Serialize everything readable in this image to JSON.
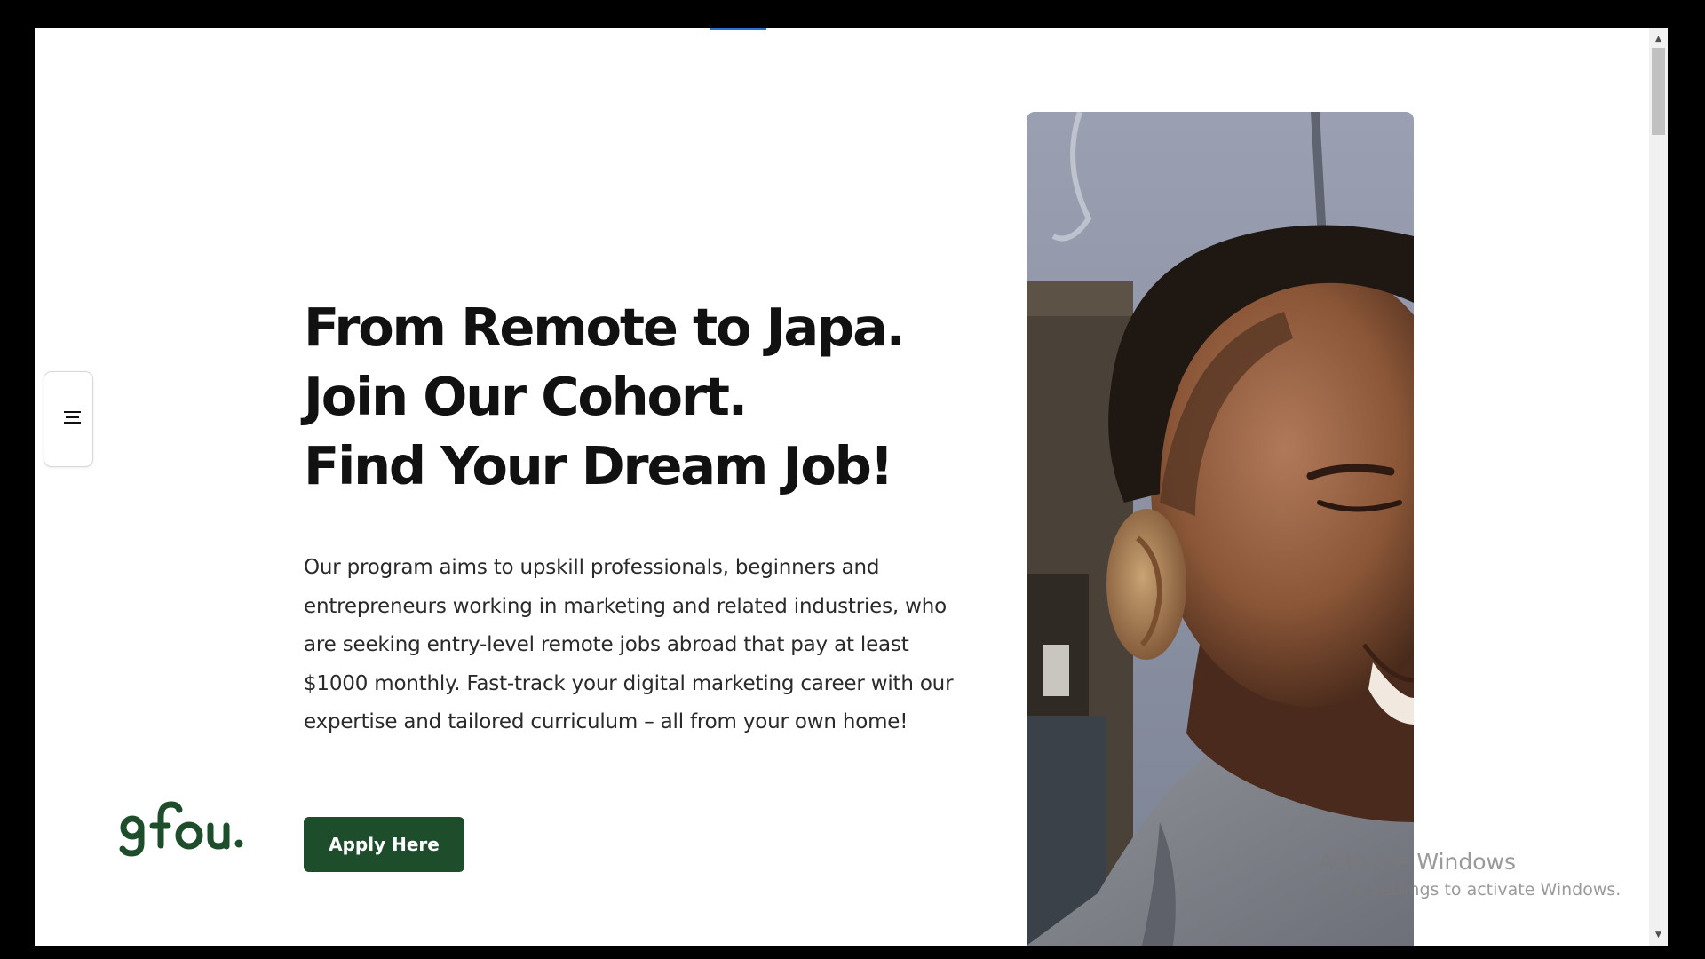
{
  "hero": {
    "headline": [
      "From Remote to Japa.",
      "Join Our Cohort.",
      "Find Your Dream Job!"
    ],
    "description": "Our program aims to upskill professionals, beginners and entrepreneurs working in marketing and related industries, who are seeking entry-level remote jobs abroad that pay at least $1000 monthly. Fast-track your digital marketing career with our expertise and tailored curriculum – all from your own home!",
    "cta_label": "Apply Here"
  },
  "brand": {
    "logo_text": "9fou.",
    "color": "#1e4d2b"
  },
  "menu": {
    "icon": "hamburger-menu-icon"
  },
  "scrollbar": {
    "up_icon": "scroll-up-arrow-icon",
    "down_icon": "scroll-down-arrow-icon"
  },
  "media": {
    "image_icon": "hero-photo-man-smiling"
  },
  "watermark": {
    "title": "Activate Windows",
    "subtitle": "Go to Settings to activate Windows."
  }
}
